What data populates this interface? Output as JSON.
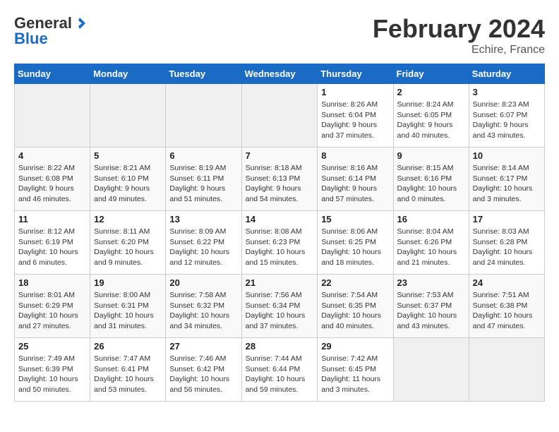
{
  "header": {
    "logo_text_general": "General",
    "logo_text_blue": "Blue",
    "month_title": "February 2024",
    "location": "Echire, France"
  },
  "days_of_week": [
    "Sunday",
    "Monday",
    "Tuesday",
    "Wednesday",
    "Thursday",
    "Friday",
    "Saturday"
  ],
  "weeks": [
    [
      {
        "day": "",
        "info": ""
      },
      {
        "day": "",
        "info": ""
      },
      {
        "day": "",
        "info": ""
      },
      {
        "day": "",
        "info": ""
      },
      {
        "day": "1",
        "info": "Sunrise: 8:26 AM\nSunset: 6:04 PM\nDaylight: 9 hours and 37 minutes."
      },
      {
        "day": "2",
        "info": "Sunrise: 8:24 AM\nSunset: 6:05 PM\nDaylight: 9 hours and 40 minutes."
      },
      {
        "day": "3",
        "info": "Sunrise: 8:23 AM\nSunset: 6:07 PM\nDaylight: 9 hours and 43 minutes."
      }
    ],
    [
      {
        "day": "4",
        "info": "Sunrise: 8:22 AM\nSunset: 6:08 PM\nDaylight: 9 hours and 46 minutes."
      },
      {
        "day": "5",
        "info": "Sunrise: 8:21 AM\nSunset: 6:10 PM\nDaylight: 9 hours and 49 minutes."
      },
      {
        "day": "6",
        "info": "Sunrise: 8:19 AM\nSunset: 6:11 PM\nDaylight: 9 hours and 51 minutes."
      },
      {
        "day": "7",
        "info": "Sunrise: 8:18 AM\nSunset: 6:13 PM\nDaylight: 9 hours and 54 minutes."
      },
      {
        "day": "8",
        "info": "Sunrise: 8:16 AM\nSunset: 6:14 PM\nDaylight: 9 hours and 57 minutes."
      },
      {
        "day": "9",
        "info": "Sunrise: 8:15 AM\nSunset: 6:16 PM\nDaylight: 10 hours and 0 minutes."
      },
      {
        "day": "10",
        "info": "Sunrise: 8:14 AM\nSunset: 6:17 PM\nDaylight: 10 hours and 3 minutes."
      }
    ],
    [
      {
        "day": "11",
        "info": "Sunrise: 8:12 AM\nSunset: 6:19 PM\nDaylight: 10 hours and 6 minutes."
      },
      {
        "day": "12",
        "info": "Sunrise: 8:11 AM\nSunset: 6:20 PM\nDaylight: 10 hours and 9 minutes."
      },
      {
        "day": "13",
        "info": "Sunrise: 8:09 AM\nSunset: 6:22 PM\nDaylight: 10 hours and 12 minutes."
      },
      {
        "day": "14",
        "info": "Sunrise: 8:08 AM\nSunset: 6:23 PM\nDaylight: 10 hours and 15 minutes."
      },
      {
        "day": "15",
        "info": "Sunrise: 8:06 AM\nSunset: 6:25 PM\nDaylight: 10 hours and 18 minutes."
      },
      {
        "day": "16",
        "info": "Sunrise: 8:04 AM\nSunset: 6:26 PM\nDaylight: 10 hours and 21 minutes."
      },
      {
        "day": "17",
        "info": "Sunrise: 8:03 AM\nSunset: 6:28 PM\nDaylight: 10 hours and 24 minutes."
      }
    ],
    [
      {
        "day": "18",
        "info": "Sunrise: 8:01 AM\nSunset: 6:29 PM\nDaylight: 10 hours and 27 minutes."
      },
      {
        "day": "19",
        "info": "Sunrise: 8:00 AM\nSunset: 6:31 PM\nDaylight: 10 hours and 31 minutes."
      },
      {
        "day": "20",
        "info": "Sunrise: 7:58 AM\nSunset: 6:32 PM\nDaylight: 10 hours and 34 minutes."
      },
      {
        "day": "21",
        "info": "Sunrise: 7:56 AM\nSunset: 6:34 PM\nDaylight: 10 hours and 37 minutes."
      },
      {
        "day": "22",
        "info": "Sunrise: 7:54 AM\nSunset: 6:35 PM\nDaylight: 10 hours and 40 minutes."
      },
      {
        "day": "23",
        "info": "Sunrise: 7:53 AM\nSunset: 6:37 PM\nDaylight: 10 hours and 43 minutes."
      },
      {
        "day": "24",
        "info": "Sunrise: 7:51 AM\nSunset: 6:38 PM\nDaylight: 10 hours and 47 minutes."
      }
    ],
    [
      {
        "day": "25",
        "info": "Sunrise: 7:49 AM\nSunset: 6:39 PM\nDaylight: 10 hours and 50 minutes."
      },
      {
        "day": "26",
        "info": "Sunrise: 7:47 AM\nSunset: 6:41 PM\nDaylight: 10 hours and 53 minutes."
      },
      {
        "day": "27",
        "info": "Sunrise: 7:46 AM\nSunset: 6:42 PM\nDaylight: 10 hours and 56 minutes."
      },
      {
        "day": "28",
        "info": "Sunrise: 7:44 AM\nSunset: 6:44 PM\nDaylight: 10 hours and 59 minutes."
      },
      {
        "day": "29",
        "info": "Sunrise: 7:42 AM\nSunset: 6:45 PM\nDaylight: 11 hours and 3 minutes."
      },
      {
        "day": "",
        "info": ""
      },
      {
        "day": "",
        "info": ""
      }
    ]
  ]
}
